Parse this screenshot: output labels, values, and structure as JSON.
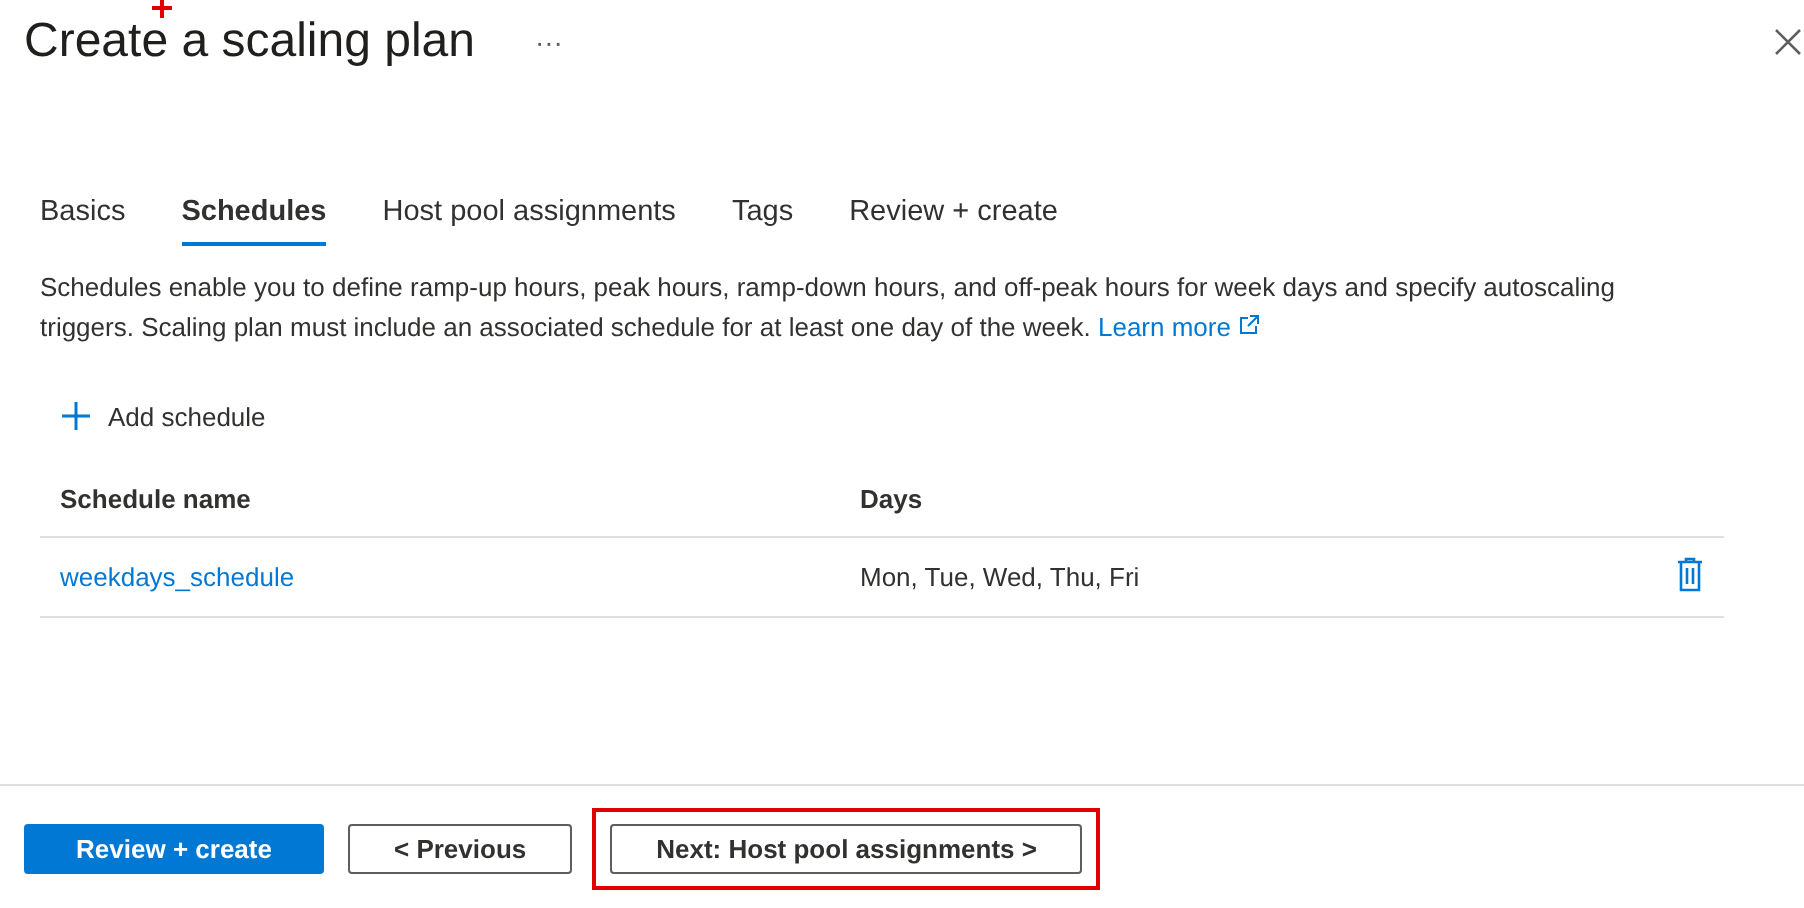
{
  "header": {
    "title": "Create a scaling plan",
    "more": "···"
  },
  "tabs": [
    {
      "label": "Basics",
      "selected": false
    },
    {
      "label": "Schedules",
      "selected": true
    },
    {
      "label": "Host pool assignments",
      "selected": false
    },
    {
      "label": "Tags",
      "selected": false
    },
    {
      "label": "Review + create",
      "selected": false
    }
  ],
  "description": {
    "text": "Schedules enable you to define ramp-up hours, peak hours, ramp-down hours, and off-peak hours for week days and specify autoscaling triggers. Scaling plan must include an associated schedule for at least one day of the week.",
    "link": "Learn more"
  },
  "add_schedule": "Add schedule",
  "table": {
    "columns": [
      "Schedule name",
      "Days"
    ],
    "rows": [
      {
        "name": "weekdays_schedule",
        "days": "Mon, Tue, Wed, Thu, Fri"
      }
    ]
  },
  "footer": {
    "buttons": [
      {
        "label": "Review + create",
        "kind": "primary",
        "highlighted": false
      },
      {
        "label": "< Previous",
        "kind": "secondary",
        "highlighted": false
      },
      {
        "label": "Next: Host pool assignments >",
        "kind": "secondary",
        "highlighted": true
      }
    ]
  }
}
